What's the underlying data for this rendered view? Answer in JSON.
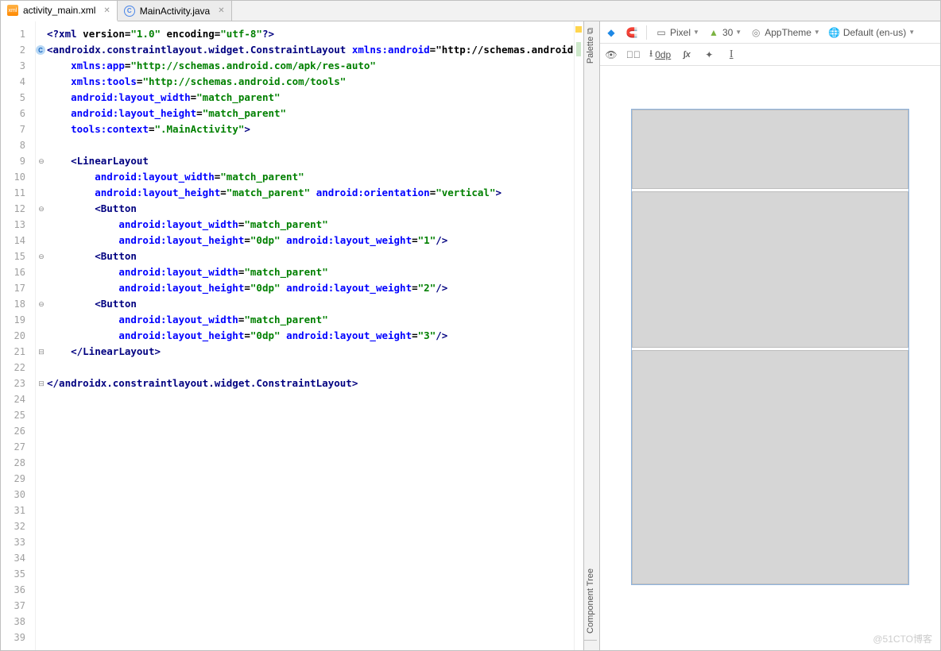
{
  "tabs": [
    {
      "label": "activity_main.xml",
      "active": true
    },
    {
      "label": "MainActivity.java",
      "active": false
    }
  ],
  "gutter_lines": 39,
  "code_lines": [
    "<?xml version=\"1.0\" encoding=\"utf-8\"?>",
    "<androidx.constraintlayout.widget.ConstraintLayout xmlns:android=\"http://schemas.android.com/apk",
    "    xmlns:app=\"http://schemas.android.com/apk/res-auto\"",
    "    xmlns:tools=\"http://schemas.android.com/tools\"",
    "    android:layout_width=\"match_parent\"",
    "    android:layout_height=\"match_parent\"",
    "    tools:context=\".MainActivity\">",
    "",
    "    <LinearLayout",
    "        android:layout_width=\"match_parent\"",
    "        android:layout_height=\"match_parent\" android:orientation=\"vertical\">",
    "        <Button",
    "            android:layout_width=\"match_parent\"",
    "            android:layout_height=\"0dp\" android:layout_weight=\"1\"/>",
    "        <Button",
    "            android:layout_width=\"match_parent\"",
    "            android:layout_height=\"0dp\" android:layout_weight=\"2\"/>",
    "        <Button",
    "            android:layout_width=\"match_parent\"",
    "            android:layout_height=\"0dp\" android:layout_weight=\"3\"/>",
    "    </LinearLayout>",
    "",
    "</androidx.constraintlayout.widget.ConstraintLayout>"
  ],
  "toolbar": {
    "device": "Pixel",
    "api": "30",
    "theme": "AppTheme",
    "locale": "Default (en-us)"
  },
  "toolbar2": {
    "dp_value": "0dp"
  },
  "side_tabs": {
    "palette": "Palette",
    "tree": "Component Tree"
  },
  "watermark": "@51CTO博客"
}
